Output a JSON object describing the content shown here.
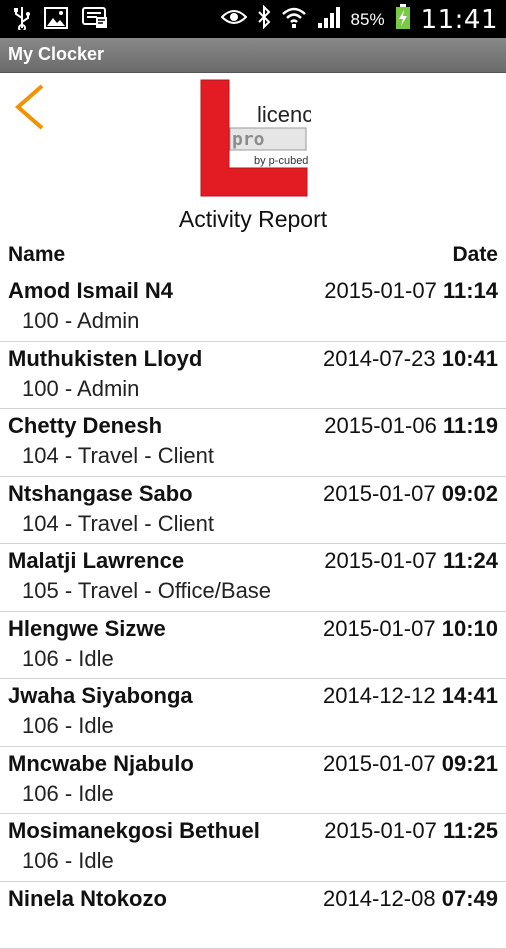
{
  "status_bar": {
    "icons_left": [
      "usb-icon",
      "image-icon",
      "sms-icon"
    ],
    "icons_right": [
      "eye-icon",
      "bluetooth-icon",
      "wifi-icon",
      "signal-icon",
      "battery-charging-icon"
    ],
    "battery_percent": "85%",
    "time": "11:41"
  },
  "app": {
    "title": "My Clocker"
  },
  "logo": {
    "line1": "licence",
    "line2": "pro",
    "line3": "by p-cubed",
    "accent_color": "#e31b23"
  },
  "report": {
    "title": "Activity Report",
    "col_name": "Name",
    "col_date": "Date"
  },
  "rows": [
    {
      "name": "Amod Ismail N4",
      "date": "2015-01-07",
      "time": "11:14",
      "status": "100 - Admin"
    },
    {
      "name": "Muthukisten Lloyd",
      "date": "2014-07-23",
      "time": "10:41",
      "status": "100 - Admin"
    },
    {
      "name": "Chetty Denesh",
      "date": "2015-01-06",
      "time": "11:19",
      "status": "104 - Travel - Client"
    },
    {
      "name": "Ntshangase Sabo",
      "date": "2015-01-07",
      "time": "09:02",
      "status": "104 - Travel - Client"
    },
    {
      "name": "Malatji Lawrence",
      "date": "2015-01-07",
      "time": "11:24",
      "status": "105 - Travel - Office/Base"
    },
    {
      "name": "Hlengwe Sizwe",
      "date": "2015-01-07",
      "time": "10:10",
      "status": "106 - Idle"
    },
    {
      "name": "Jwaha Siyabonga",
      "date": "2014-12-12",
      "time": "14:41",
      "status": "106 - Idle"
    },
    {
      "name": "Mncwabe Njabulo",
      "date": "2015-01-07",
      "time": "09:21",
      "status": "106 - Idle"
    },
    {
      "name": "Mosimanekgosi Bethuel",
      "date": "2015-01-07",
      "time": "11:25",
      "status": "106 - Idle"
    },
    {
      "name": "Ninela Ntokozo",
      "date": "2014-12-08",
      "time": "07:49",
      "status": ""
    }
  ],
  "colors": {
    "back_arrow": "#f39200",
    "title_bar": "#777777",
    "divider": "#d4d4d4"
  }
}
